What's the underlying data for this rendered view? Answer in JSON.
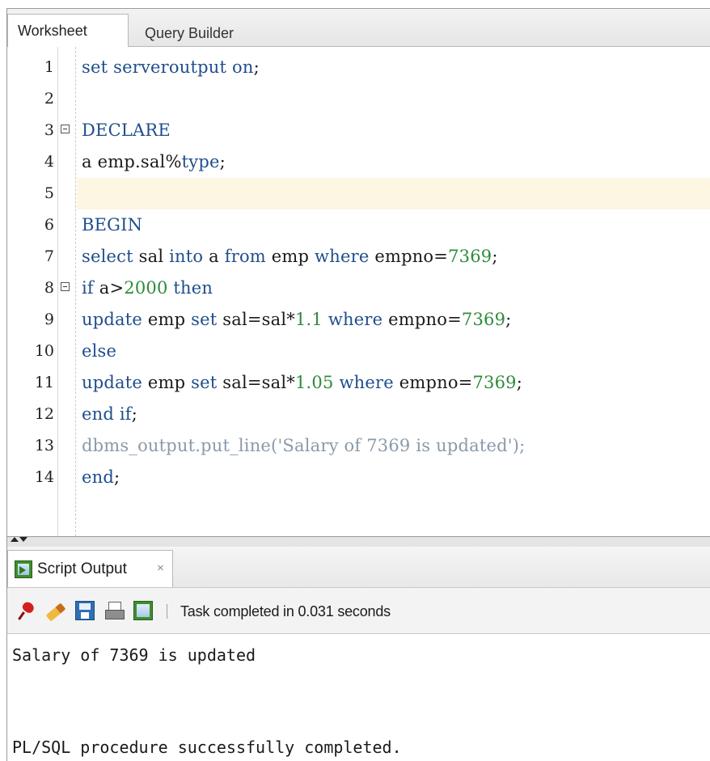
{
  "worksheet_tabs": [
    {
      "label": "Worksheet",
      "active": true
    },
    {
      "label": "Query Builder",
      "active": false
    }
  ],
  "editor": {
    "current_line": 5,
    "lines": [
      {
        "n": "1",
        "tokens": [
          {
            "t": "set serveroutput on",
            "c": "kw"
          },
          {
            "t": ";",
            "c": "plain"
          }
        ]
      },
      {
        "n": "2",
        "tokens": []
      },
      {
        "n": "3",
        "fold": true,
        "tokens": [
          {
            "t": "DECLARE",
            "c": "kw"
          }
        ]
      },
      {
        "n": "4",
        "tokens": [
          {
            "t": "a emp.sal%",
            "c": "plain"
          },
          {
            "t": "type",
            "c": "kw"
          },
          {
            "t": ";",
            "c": "plain"
          }
        ]
      },
      {
        "n": "5",
        "tokens": []
      },
      {
        "n": "6",
        "tokens": [
          {
            "t": "BEGIN",
            "c": "kw"
          }
        ]
      },
      {
        "n": "7",
        "tokens": [
          {
            "t": "select",
            "c": "kw"
          },
          {
            "t": " sal ",
            "c": "plain"
          },
          {
            "t": "into",
            "c": "kw"
          },
          {
            "t": " a ",
            "c": "plain"
          },
          {
            "t": "from",
            "c": "kw"
          },
          {
            "t": " emp ",
            "c": "plain"
          },
          {
            "t": "where",
            "c": "kw"
          },
          {
            "t": " empno=",
            "c": "plain"
          },
          {
            "t": "7369",
            "c": "num"
          },
          {
            "t": ";",
            "c": "plain"
          }
        ]
      },
      {
        "n": "8",
        "fold": true,
        "tokens": [
          {
            "t": "if",
            "c": "kw"
          },
          {
            "t": " a>",
            "c": "plain"
          },
          {
            "t": "2000",
            "c": "num"
          },
          {
            "t": " then",
            "c": "kw"
          }
        ]
      },
      {
        "n": "9",
        "tokens": [
          {
            "t": "update",
            "c": "kw"
          },
          {
            "t": " emp ",
            "c": "plain"
          },
          {
            "t": "set",
            "c": "kw"
          },
          {
            "t": " sal=sal*",
            "c": "plain"
          },
          {
            "t": "1.1",
            "c": "num"
          },
          {
            "t": " where",
            "c": "kw"
          },
          {
            "t": " empno=",
            "c": "plain"
          },
          {
            "t": "7369",
            "c": "num"
          },
          {
            "t": ";",
            "c": "plain"
          }
        ]
      },
      {
        "n": "10",
        "tokens": [
          {
            "t": "else",
            "c": "kw"
          }
        ]
      },
      {
        "n": "11",
        "tokens": [
          {
            "t": "update",
            "c": "kw"
          },
          {
            "t": " emp ",
            "c": "plain"
          },
          {
            "t": "set",
            "c": "kw"
          },
          {
            "t": " sal=sal*",
            "c": "plain"
          },
          {
            "t": "1.05",
            "c": "num"
          },
          {
            "t": " where",
            "c": "kw"
          },
          {
            "t": " empno=",
            "c": "plain"
          },
          {
            "t": "7369",
            "c": "num"
          },
          {
            "t": ";",
            "c": "plain"
          }
        ]
      },
      {
        "n": "12",
        "tokens": [
          {
            "t": "end if",
            "c": "kw"
          },
          {
            "t": ";",
            "c": "plain"
          }
        ]
      },
      {
        "n": "13",
        "tokens": [
          {
            "t": "dbms_output.put_line('Salary of 7369 is updated');",
            "c": "muted"
          }
        ]
      },
      {
        "n": "14",
        "tokens": [
          {
            "t": "end",
            "c": "kw"
          },
          {
            "t": ";",
            "c": "plain"
          }
        ]
      }
    ]
  },
  "output_panel": {
    "tab_label": "Script Output",
    "tab_close": "×",
    "toolbar_icons": [
      "pin-icon",
      "eraser-icon",
      "save-icon",
      "print-icon",
      "script-icon"
    ],
    "status": "Task completed in 0.031 seconds",
    "lines": [
      "Salary of 7369 is updated",
      "",
      "",
      "PL/SQL procedure successfully completed."
    ]
  },
  "colors": {
    "keyword": "#1f4e8c",
    "number": "#2e8b3a",
    "comment_like": "#8a9aaa",
    "current_line": "#fdf6e3"
  }
}
